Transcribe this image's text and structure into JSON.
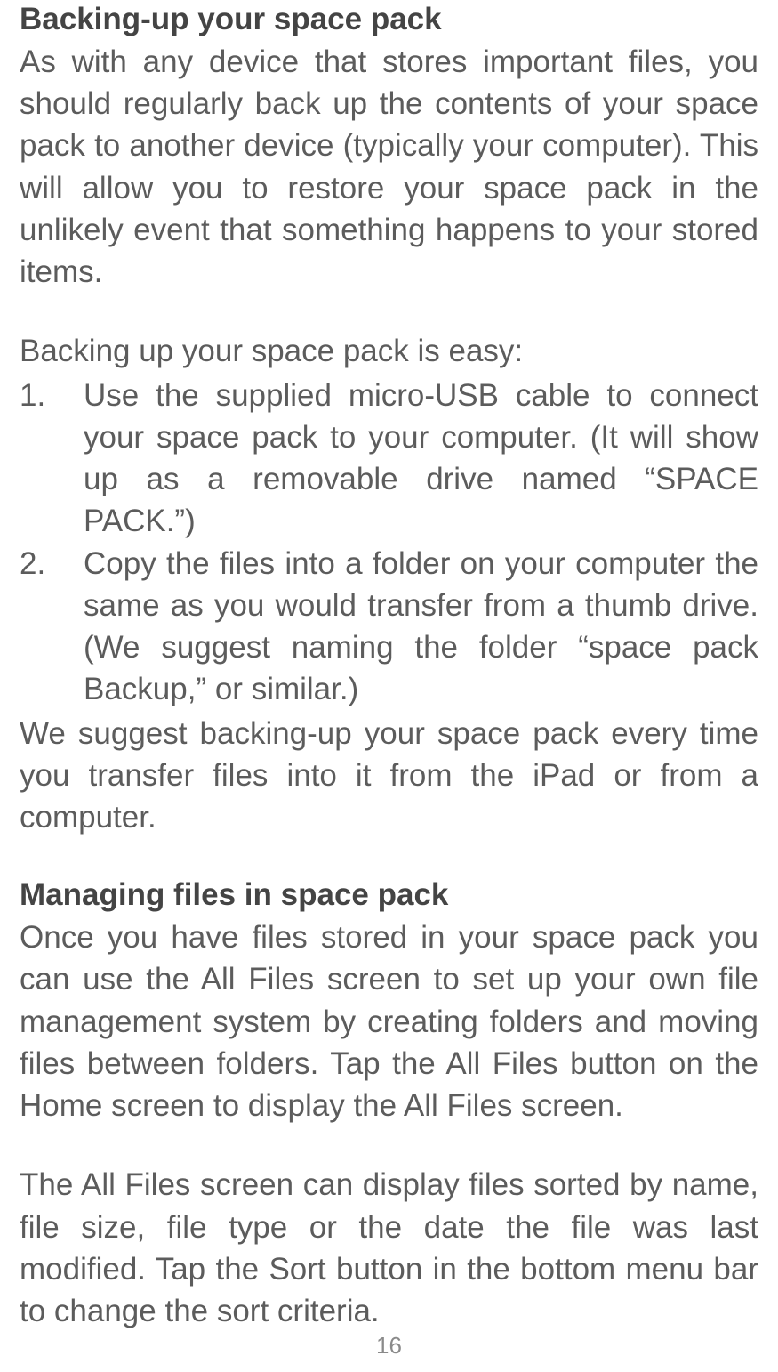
{
  "section1": {
    "heading": "Backing-up your space pack",
    "paragraph1": "As with any device that stores important files, you should regularly back up the contents of your space pack to another device (typically your computer). This will allow you to restore your space pack in the unlikely event that something happens to your stored items.",
    "intro": "Backing up your space pack is easy:",
    "list": [
      {
        "num": "1.",
        "text": "Use the supplied micro-USB cable to connect your space pack to your computer. (It will show up as a removable drive named “SPACE PACK.”)"
      },
      {
        "num": "2.",
        "text": "Copy the files into a folder on your computer the same as you would transfer from a thumb drive. (We suggest naming the folder “space pack Backup,” or similar.)"
      }
    ],
    "afterList": "We suggest backing-up your space pack every time you transfer files into it from the iPad or from a computer."
  },
  "section2": {
    "heading": "Managing files in space pack",
    "paragraph1": "Once you have files stored in your space pack you can use the All Files screen to set up your own file management system by creating folders and moving files between folders. Tap the All Files button on the Home screen to display the All Files screen.",
    "paragraph2": "The All Files screen can display files sorted by name, file size, file type or the date the file was last modified. Tap the Sort button in the bottom menu bar to change the sort criteria."
  },
  "pageNumber": "16"
}
